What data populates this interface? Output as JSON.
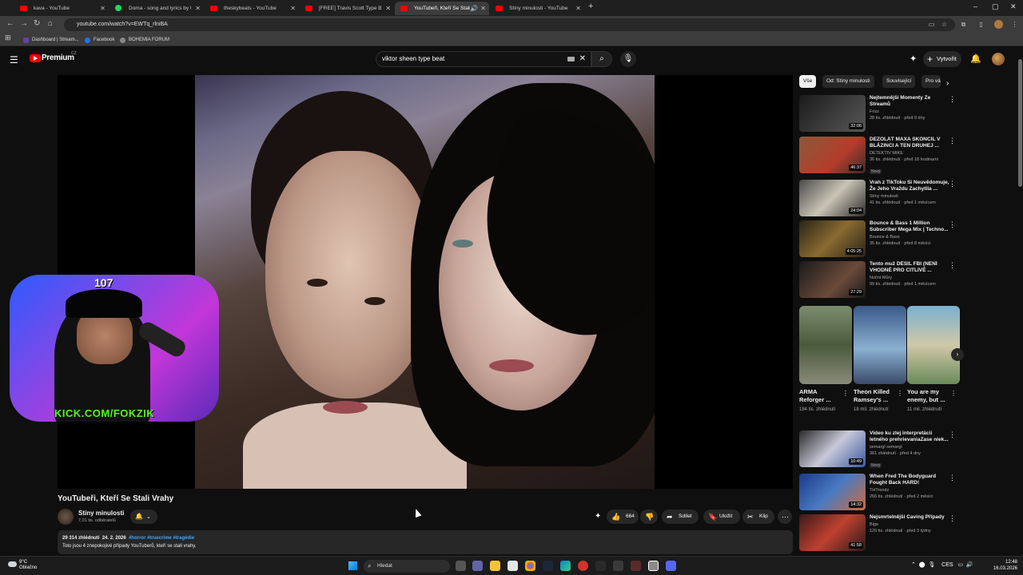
{
  "browser": {
    "tabs": [
      {
        "label": "kava - YouTube",
        "active": false,
        "icon": "youtube-icon"
      },
      {
        "label": "Doma - song and lyrics by tobi",
        "active": false,
        "icon": "spotify-icon"
      },
      {
        "label": "theskybeats - YouTube",
        "active": false,
        "icon": "youtube-icon"
      },
      {
        "label": "[FREE] Travis Scott Type Beat -",
        "active": false,
        "icon": "youtube-icon"
      },
      {
        "label": "YouTubeři, Kteří Se Stali Vra",
        "active": true,
        "icon": "youtube-icon"
      },
      {
        "label": "Stíny minulosti - YouTube",
        "active": false,
        "icon": "youtube-icon"
      }
    ],
    "url": "youtube.com/watch?v=EWTq_rlniBA",
    "bookmarks": [
      {
        "label": "Dashboard | Stream...",
        "color": "#6441a5"
      },
      {
        "label": "Facebook",
        "color": "#1877f2"
      },
      {
        "label": "BOHEMIA FORUM",
        "color": "#888888"
      }
    ]
  },
  "youtube": {
    "brand": "Premium",
    "region": "CZ",
    "search_query": "viktor sheen type beat",
    "create_label": "Vytvořit"
  },
  "overlay": {
    "counter": "107",
    "kick": "KICK.COM/FOKZIK"
  },
  "video": {
    "title": "YouTubeři, Kteří Se Stali Vrahy",
    "channel": "Stíny minulosti",
    "subscribers": "7,01 tis. odběratelů",
    "likes": "664",
    "share_label": "Sdílet",
    "save_label": "Uložit",
    "clip_label": "Klip",
    "views": "29 314 zhlédnutí",
    "date": "24. 2. 2026",
    "tags": "#horror #truecrime #tragédie",
    "description": "Toto jsou 4 znepokojivé případy YouTuberů, kteří se stali vrahy."
  },
  "chips": [
    "Vše",
    "Od: Stíny minulosti",
    "Související",
    "Pro vás"
  ],
  "recommendations_top": [
    {
      "title": "Nejtemnější Momenty Ze Streamů",
      "channel": "Frizz",
      "meta": "28 tis. zhlédnutí · před 9 dny",
      "duration": "32:06",
      "badge": "",
      "color": "#2b2b2b"
    },
    {
      "title": "DEZOLÁT MAXA SKONČIL V BLÁZINCI A TEN DRUHEJ ...",
      "channel": "DETEKTIV MIKE",
      "meta": "36 tis. zhlédnutí · před 18 hodinami",
      "duration": "46:37",
      "badge": "Nový",
      "color": "#7a4a3a"
    },
    {
      "title": "Vrah z TikToku Si Neuvědomuje, Že Jeho Vraždu Zachytila ...",
      "channel": "Stíny minulosti",
      "meta": "41 tis. zhlédnutí · před 1 měsícem",
      "duration": "24:04",
      "badge": "",
      "color": "#3a3a3a"
    },
    {
      "title": "Bounce & Bass 1 Million Subscriber Mega Mix | Techno...",
      "channel": "Bounce & Bass",
      "meta": "35 tis. zhlédnutí · před 8 měsíci",
      "duration": "4:05:25",
      "badge": "",
      "color": "#5a4a2a"
    },
    {
      "title": "Tento muž DĚSIL FBI (NENÍ VHODNÉ PRO CITLIVÉ ...",
      "channel": "Noční Můry",
      "meta": "99 tis. zhlédnutí · před 1 měsícem",
      "duration": "27:29",
      "badge": "",
      "color": "#3a2a2a"
    }
  ],
  "shorts": [
    {
      "title": "ARMA Reforger ...",
      "views": "184 tis. zhlédnutí",
      "color": "#6f7a5a"
    },
    {
      "title": "Theon Killed Ramsey's ...",
      "views": "18 mil. zhlédnutí",
      "color": "#4a6a8a"
    },
    {
      "title": "You are my enemy, but ...",
      "views": "11 mil. zhlédnutí",
      "color": "#5a8aa0"
    }
  ],
  "recommendations_bottom": [
    {
      "title": "Video ku zlej interpretácii letného prehrievaniaZase niek...",
      "channel": "semargl semargl",
      "meta": "361 zhlédnutí · před 4 dny",
      "duration": "10:49",
      "badge": "Nový",
      "color": "#3a3a3a"
    },
    {
      "title": "When Fred The Bodyguard Fought Back HARD!",
      "channel": "THTrendz",
      "meta": "266 tis. zhlédnutí · před 2 měsíci",
      "duration": "14:32",
      "badge": "",
      "color": "#2a4a8a"
    },
    {
      "title": "Nejsmrtelnější Caving Případy",
      "channel": "Bige",
      "meta": "126 tis. zhlédnutí · před 3 týdny",
      "duration": "41:58",
      "badge": "",
      "color": "#6a2a2a"
    }
  ],
  "taskbar": {
    "temperature": "9°C",
    "weather": "Oblačno",
    "search_label": "Hledat",
    "language": "CES",
    "time": "12:48",
    "date": "16.03.2026"
  }
}
